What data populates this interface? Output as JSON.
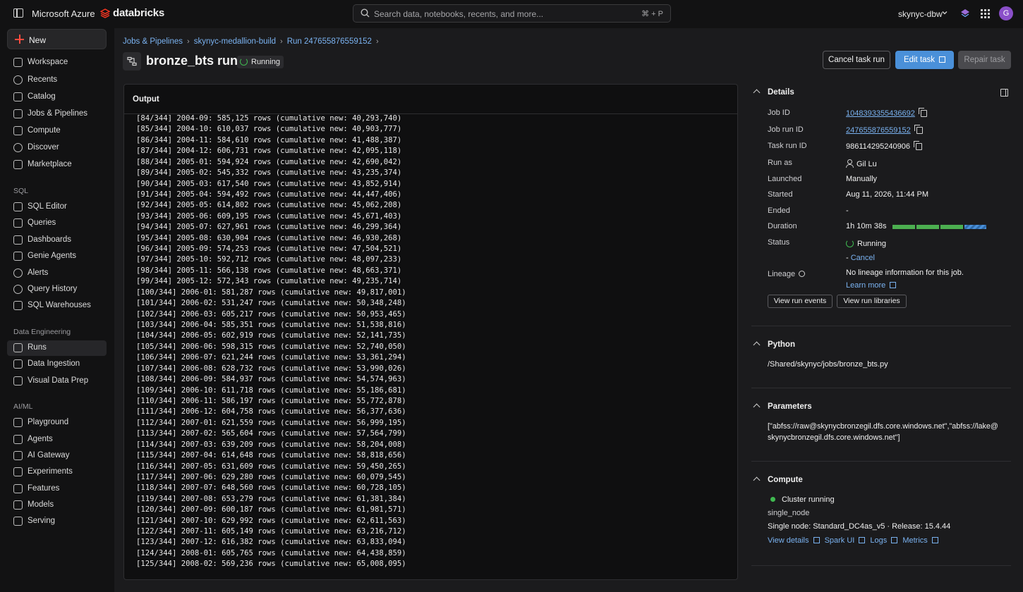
{
  "topbar": {
    "cloud": "Microsoft Azure",
    "brand": "databricks",
    "search_placeholder": "Search data, notebooks, recents, and more...",
    "search_shortcut": "⌘ + P",
    "workspace": "skynyc-dbw",
    "avatar": "G"
  },
  "sidebar": {
    "new_label": "New",
    "items_top": [
      "Workspace",
      "Recents",
      "Catalog",
      "Jobs & Pipelines",
      "Compute",
      "Discover",
      "Marketplace"
    ],
    "sql_title": "SQL",
    "items_sql": [
      "SQL Editor",
      "Queries",
      "Dashboards",
      "Genie Agents",
      "Alerts",
      "Query History",
      "SQL Warehouses"
    ],
    "de_title": "Data Engineering",
    "items_de": [
      "Runs",
      "Data Ingestion",
      "Visual Data Prep"
    ],
    "aiml_title": "AI/ML",
    "items_aiml": [
      "Playground",
      "Agents",
      "AI Gateway",
      "Experiments",
      "Features",
      "Models",
      "Serving"
    ]
  },
  "breadcrumb": [
    "Jobs & Pipelines",
    "skynyc-medallion-build",
    "Run 247655876559152"
  ],
  "title": "bronze_bts run",
  "status": "Running",
  "buttons": {
    "cancel": "Cancel task run",
    "edit": "Edit task",
    "repair": "Repair task"
  },
  "output": {
    "title": "Output",
    "lines": [
      "[84/344] 2004-09: 585,125 rows (cumulative new: 40,293,740)",
      "[85/344] 2004-10: 610,037 rows (cumulative new: 40,903,777)",
      "[86/344] 2004-11: 584,610 rows (cumulative new: 41,488,387)",
      "[87/344] 2004-12: 606,731 rows (cumulative new: 42,095,118)",
      "[88/344] 2005-01: 594,924 rows (cumulative new: 42,690,042)",
      "[89/344] 2005-02: 545,332 rows (cumulative new: 43,235,374)",
      "[90/344] 2005-03: 617,540 rows (cumulative new: 43,852,914)",
      "[91/344] 2005-04: 594,492 rows (cumulative new: 44,447,406)",
      "[92/344] 2005-05: 614,802 rows (cumulative new: 45,062,208)",
      "[93/344] 2005-06: 609,195 rows (cumulative new: 45,671,403)",
      "[94/344] 2005-07: 627,961 rows (cumulative new: 46,299,364)",
      "[95/344] 2005-08: 630,904 rows (cumulative new: 46,930,268)",
      "[96/344] 2005-09: 574,253 rows (cumulative new: 47,504,521)",
      "[97/344] 2005-10: 592,712 rows (cumulative new: 48,097,233)",
      "[98/344] 2005-11: 566,138 rows (cumulative new: 48,663,371)",
      "[99/344] 2005-12: 572,343 rows (cumulative new: 49,235,714)",
      "[100/344] 2006-01: 581,287 rows (cumulative new: 49,817,001)",
      "[101/344] 2006-02: 531,247 rows (cumulative new: 50,348,248)",
      "[102/344] 2006-03: 605,217 rows (cumulative new: 50,953,465)",
      "[103/344] 2006-04: 585,351 rows (cumulative new: 51,538,816)",
      "[104/344] 2006-05: 602,919 rows (cumulative new: 52,141,735)",
      "[105/344] 2006-06: 598,315 rows (cumulative new: 52,740,050)",
      "[106/344] 2006-07: 621,244 rows (cumulative new: 53,361,294)",
      "[107/344] 2006-08: 628,732 rows (cumulative new: 53,990,026)",
      "[108/344] 2006-09: 584,937 rows (cumulative new: 54,574,963)",
      "[109/344] 2006-10: 611,718 rows (cumulative new: 55,186,681)",
      "[110/344] 2006-11: 586,197 rows (cumulative new: 55,772,878)",
      "[111/344] 2006-12: 604,758 rows (cumulative new: 56,377,636)",
      "[112/344] 2007-01: 621,559 rows (cumulative new: 56,999,195)",
      "[113/344] 2007-02: 565,604 rows (cumulative new: 57,564,799)",
      "[114/344] 2007-03: 639,209 rows (cumulative new: 58,204,008)",
      "[115/344] 2007-04: 614,648 rows (cumulative new: 58,818,656)",
      "[116/344] 2007-05: 631,609 rows (cumulative new: 59,450,265)",
      "[117/344] 2007-06: 629,280 rows (cumulative new: 60,079,545)",
      "[118/344] 2007-07: 648,560 rows (cumulative new: 60,728,105)",
      "[119/344] 2007-08: 653,279 rows (cumulative new: 61,381,384)",
      "[120/344] 2007-09: 600,187 rows (cumulative new: 61,981,571)",
      "[121/344] 2007-10: 629,992 rows (cumulative new: 62,611,563)",
      "[122/344] 2007-11: 605,149 rows (cumulative new: 63,216,712)",
      "[123/344] 2007-12: 616,382 rows (cumulative new: 63,833,094)",
      "[124/344] 2008-01: 605,765 rows (cumulative new: 64,438,859)",
      "[125/344] 2008-02: 569,236 rows (cumulative new: 65,008,095)"
    ]
  },
  "details": {
    "title": "Details",
    "job_id_label": "Job ID",
    "job_id": "1048393355436692",
    "job_run_id_label": "Job run ID",
    "job_run_id": "247655876559152",
    "task_run_id_label": "Task run ID",
    "task_run_id": "986114295240906",
    "run_as_label": "Run as",
    "run_as": "Gil Lu",
    "launched_label": "Launched",
    "launched": "Manually",
    "started_label": "Started",
    "started": "Aug 11, 2026, 11:44 PM",
    "ended_label": "Ended",
    "ended": "-",
    "duration_label": "Duration",
    "duration": "1h 10m 38s",
    "status_label": "Status",
    "status": "Running",
    "cancel_prefix": "-",
    "cancel_link": "Cancel",
    "lineage_label": "Lineage",
    "lineage_text": "No lineage information for this job.",
    "learn_more": "Learn more",
    "view_events": "View run events",
    "view_libraries": "View run libraries"
  },
  "python": {
    "title": "Python",
    "path": "/Shared/skynyc/jobs/bronze_bts.py"
  },
  "parameters": {
    "title": "Parameters",
    "line1": "[\"abfss://raw@skynycbronzegil.dfs.core.windows.net\",\"abfss://lake@",
    "line2": "skynycbronzegil.dfs.core.windows.net\"]"
  },
  "compute": {
    "title": "Compute",
    "cluster_status": "Cluster running",
    "mode": "single_node",
    "spec": "Single node: Standard_DC4as_v5 · Release: 15.4.44",
    "links": [
      "View details",
      "Spark UI",
      "Logs",
      "Metrics"
    ]
  },
  "colors": {
    "accent": "#4a90d9",
    "link": "#7ab2f0",
    "running": "#3fb950",
    "brand": "#ff3621"
  }
}
